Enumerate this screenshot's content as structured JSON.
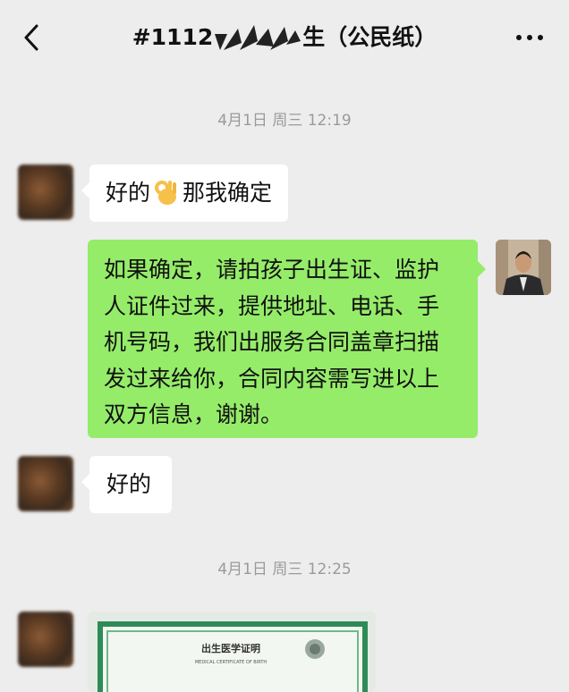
{
  "header": {
    "title_prefix": "#1112",
    "title_suffix": "生（公民纸）",
    "back_icon": "chevron-left-icon",
    "more_icon": "more-dots-icon"
  },
  "messages": [
    {
      "type": "time",
      "text": "4月1日 周三 12:19"
    },
    {
      "type": "text",
      "side": "left",
      "parts": [
        "好的",
        "那我确定"
      ],
      "emoji": "ok-hand"
    },
    {
      "type": "text",
      "side": "right",
      "lines": [
        "如果确定，请拍孩子出生证、监护",
        "人证件过来，提供地址、电话、手",
        "机号码，我们出服务合同盖章扫描",
        "发过来给你，合同内容需写进以上",
        "双方信息，谢谢。"
      ]
    },
    {
      "type": "text",
      "side": "left",
      "text": "好的"
    },
    {
      "type": "time",
      "text": "4月1日 周三 12:25"
    },
    {
      "type": "image",
      "side": "left",
      "caption_cn": "出生医学证明",
      "caption_en": "MEDICAL CERTIFICATE OF BIRTH"
    }
  ],
  "colors": {
    "background": "#ededed",
    "bubble_left": "#ffffff",
    "bubble_right": "#95ec69",
    "time": "#9a9a9a",
    "cert_border": "#2e8b57"
  }
}
